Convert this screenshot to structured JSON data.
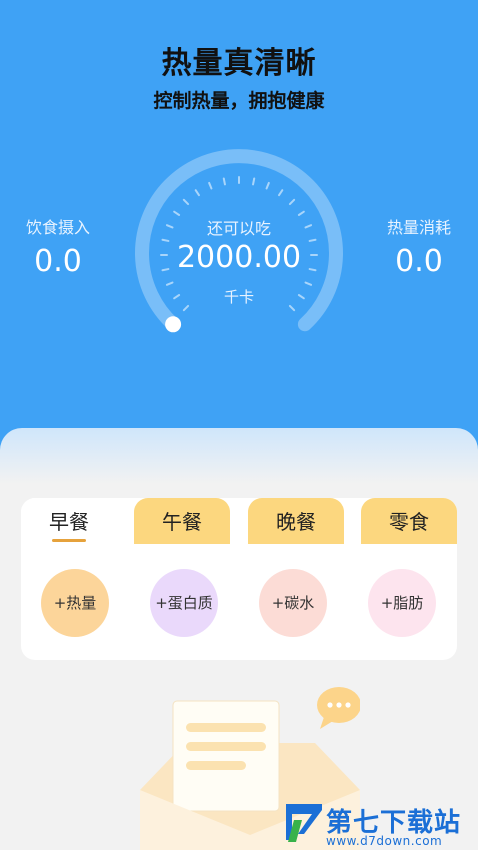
{
  "header": {
    "title": "热量真清晰",
    "subtitle": "控制热量，拥抱健康"
  },
  "stats": {
    "intake_label": "饮食摄入",
    "intake_value": "0.0",
    "remaining_label": "还可以吃",
    "remaining_value": "2000.00",
    "remaining_unit": "千卡",
    "burn_label": "热量消耗",
    "burn_value": "0.0",
    "gauge_progress": 0
  },
  "meals": {
    "tabs": [
      {
        "label": "早餐",
        "active": true
      },
      {
        "label": "午餐",
        "active": false
      },
      {
        "label": "晚餐",
        "active": false
      },
      {
        "label": "零食",
        "active": false
      }
    ],
    "buttons": [
      {
        "label": "+热量"
      },
      {
        "label": "+蛋白质"
      },
      {
        "label": "+碳水"
      },
      {
        "label": "+脂肪"
      }
    ]
  },
  "watermark": {
    "text": "第七下载站",
    "url": "www.d7down.com"
  },
  "colors": {
    "primary": "#3fa2f5",
    "tab_inactive": "#fcd77f",
    "watermark": "#1b6fd6"
  }
}
